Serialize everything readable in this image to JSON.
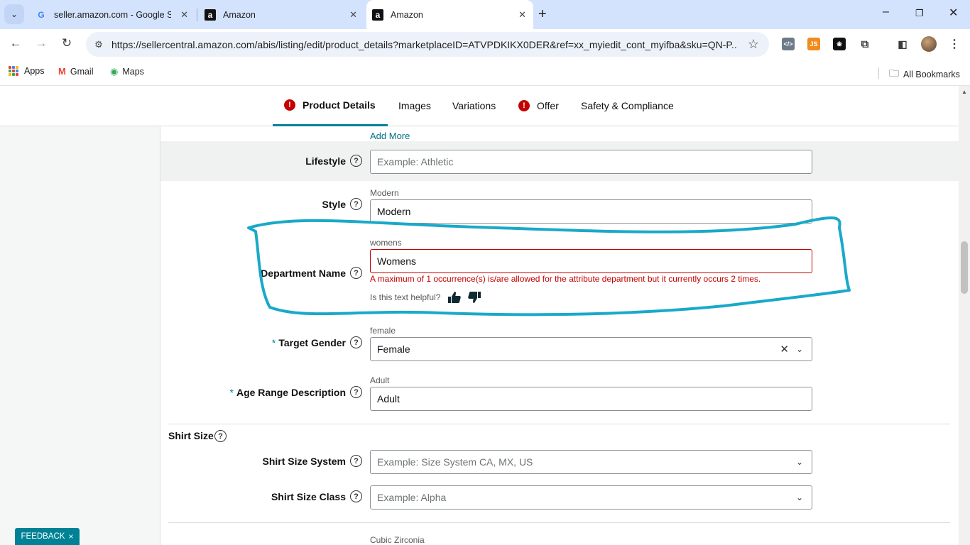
{
  "browser": {
    "tabs": [
      {
        "title": "seller.amazon.com - Google Se",
        "icon": "google-icon"
      },
      {
        "title": "Amazon",
        "icon": "amazon-icon"
      },
      {
        "title": "Amazon",
        "icon": "amazon-icon",
        "active": true
      }
    ],
    "url": "https://sellercentral.amazon.com/abis/listing/edit/product_details?marketplaceID=ATVPDKIKX0DER&ref=xx_myiedit_cont_myifba&sku=QN-P...",
    "bookmarks": [
      "Apps",
      "Gmail",
      "Maps"
    ],
    "all_bookmarks": "All Bookmarks",
    "extensions": {
      "js_label": "JS"
    }
  },
  "subnav": {
    "tabs": [
      {
        "label": "Product Details",
        "error": true,
        "active": true
      },
      {
        "label": "Images"
      },
      {
        "label": "Variations"
      },
      {
        "label": "Offer",
        "error": true
      },
      {
        "label": "Safety & Compliance"
      }
    ],
    "error_glyph": "!"
  },
  "form": {
    "add_more": "Add More",
    "help_glyph": "?",
    "lifestyle": {
      "label": "Lifestyle",
      "placeholder": "Example: Athletic"
    },
    "style": {
      "label": "Style",
      "hint": "Modern",
      "value": "Modern"
    },
    "department": {
      "label": "Department Name",
      "hint": "womens",
      "value": "Womens",
      "error": "A maximum of 1 occurrence(s) is/are allowed for the attribute department but it currently occurs 2 times.",
      "helpful_prompt": "Is this text helpful?"
    },
    "target_gender": {
      "required_mark": "*",
      "label": "Target Gender",
      "hint": "female",
      "value": "Female"
    },
    "age_range": {
      "required_mark": "*",
      "label": "Age Range Description",
      "hint": "Adult",
      "value": "Adult"
    },
    "shirt_size_section": "Shirt Size",
    "shirt_size_system": {
      "label": "Shirt Size System",
      "placeholder": "Example: Size System CA, MX, US"
    },
    "shirt_size_class": {
      "label": "Shirt Size Class",
      "placeholder": "Example: Alpha"
    },
    "next_hint": "Cubic Zirconia"
  },
  "feedback": {
    "label": "FEEDBACK",
    "close": "×"
  },
  "colors": {
    "teal": "#008296",
    "error": "#c40000",
    "annotation": "#19a9c9"
  }
}
